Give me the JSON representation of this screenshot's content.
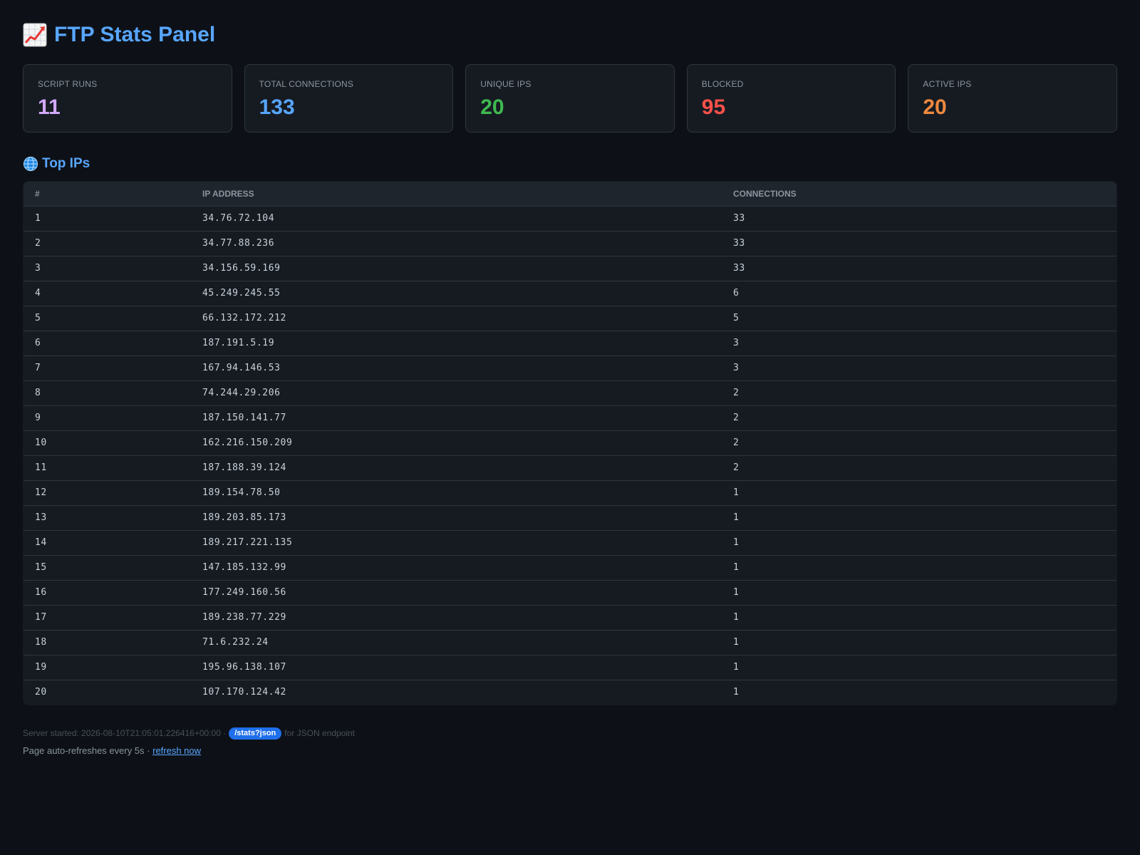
{
  "header": {
    "title": "FTP Stats Panel",
    "icon": "chart-increasing-icon"
  },
  "stats": [
    {
      "label": "SCRIPT RUNS",
      "value": "11",
      "color": "#d2a8ff"
    },
    {
      "label": "TOTAL CONNECTIONS",
      "value": "133",
      "color": "#58a6ff"
    },
    {
      "label": "UNIQUE IPS",
      "value": "20",
      "color": "#3fb950"
    },
    {
      "label": "BLOCKED",
      "value": "95",
      "color": "#f85149"
    },
    {
      "label": "ACTIVE IPS",
      "value": "20",
      "color": "#f0883e"
    }
  ],
  "top_ips": {
    "title": "Top IPs",
    "icon": "globe-icon",
    "columns": [
      "#",
      "IP ADDRESS",
      "CONNECTIONS"
    ],
    "rows": [
      [
        "1",
        "34.76.72.104",
        "33"
      ],
      [
        "2",
        "34.77.88.236",
        "33"
      ],
      [
        "3",
        "34.156.59.169",
        "33"
      ],
      [
        "4",
        "45.249.245.55",
        "6"
      ],
      [
        "5",
        "66.132.172.212",
        "5"
      ],
      [
        "6",
        "187.191.5.19",
        "3"
      ],
      [
        "7",
        "167.94.146.53",
        "3"
      ],
      [
        "8",
        "74.244.29.206",
        "2"
      ],
      [
        "9",
        "187.150.141.77",
        "2"
      ],
      [
        "10",
        "162.216.150.209",
        "2"
      ],
      [
        "11",
        "187.188.39.124",
        "2"
      ],
      [
        "12",
        "189.154.78.50",
        "1"
      ],
      [
        "13",
        "189.203.85.173",
        "1"
      ],
      [
        "14",
        "189.217.221.135",
        "1"
      ],
      [
        "15",
        "147.185.132.99",
        "1"
      ],
      [
        "16",
        "177.249.160.56",
        "1"
      ],
      [
        "17",
        "189.238.77.229",
        "1"
      ],
      [
        "18",
        "71.6.232.24",
        "1"
      ],
      [
        "19",
        "195.96.138.107",
        "1"
      ],
      [
        "20",
        "107.170.124.42",
        "1"
      ]
    ]
  },
  "footer": {
    "server_started": "Server started: 2026-08-10T21:05:01.226416+00:00 ·",
    "json_badge": "/stats?json",
    "json_suffix": "for JSON endpoint",
    "refresh_text": "Page auto-refreshes every 5s ·",
    "refresh_link": "refresh now"
  }
}
